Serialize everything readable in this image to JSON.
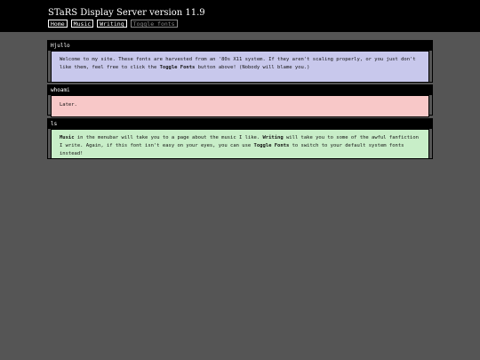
{
  "header": {
    "title": "STaRS Display Server version 11.9",
    "menu": [
      {
        "label": "Home"
      },
      {
        "label": "Music"
      },
      {
        "label": "Writing"
      },
      {
        "label": "Toggle fonts"
      }
    ]
  },
  "windows": [
    {
      "title": "Hjullo",
      "body_parts": [
        "Welcome to my site. These fonts are harvested from an '80s X11 system. If they aren't scaling properly, or you just don't like them, feel free to click the ",
        "Toggle Fonts",
        " button above! (Nobody will blame you.)"
      ],
      "color": "#c8c8ec"
    },
    {
      "title": "whoami",
      "body": "Later.",
      "color": "#f8c8c8"
    },
    {
      "title": "ls",
      "body_parts": [
        "Music",
        " in the menubar will take you to a page about the music I like. ",
        "Writing",
        " will take you to some of the awful fanfiction I write. Again, if this font isn't easy on your eyes, you can use ",
        "Toggle Fonts",
        " to switch to your default system fonts instead!"
      ],
      "color": "#c8eec8"
    }
  ]
}
